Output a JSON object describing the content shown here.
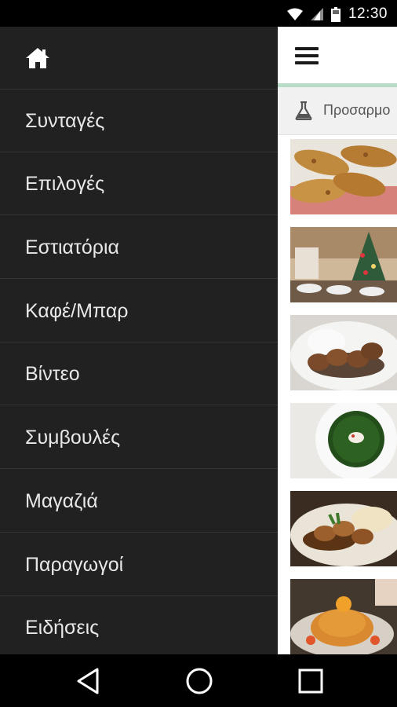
{
  "status_bar": {
    "time": "12:30"
  },
  "drawer": {
    "items": [
      {
        "label": "Συνταγές"
      },
      {
        "label": "Επιλογές"
      },
      {
        "label": "Εστιατόρια"
      },
      {
        "label": "Καφέ/Μπαρ"
      },
      {
        "label": "Βίντεο"
      },
      {
        "label": "Συμβουλές"
      },
      {
        "label": "Μαγαζιά"
      },
      {
        "label": "Παραγωγοί"
      },
      {
        "label": "Ειδήσεις"
      }
    ]
  },
  "content": {
    "filter_text": "Προσαρμο"
  },
  "colors": {
    "drawer_bg": "#212121",
    "accent_line": "#b9dcc8"
  }
}
